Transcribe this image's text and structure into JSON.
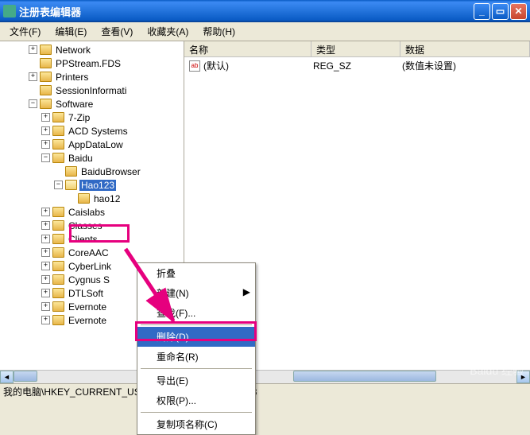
{
  "window": {
    "title": "注册表编辑器"
  },
  "menubar": {
    "file": "文件(F)",
    "edit": "编辑(E)",
    "view": "查看(V)",
    "favorites": "收藏夹(A)",
    "help": "帮助(H)"
  },
  "tree": {
    "nodes": [
      {
        "indent": 2,
        "exp": "plus",
        "label": "Network"
      },
      {
        "indent": 2,
        "exp": "none",
        "label": "PPStream.FDS"
      },
      {
        "indent": 2,
        "exp": "plus",
        "label": "Printers"
      },
      {
        "indent": 2,
        "exp": "none",
        "label": "SessionInformati"
      },
      {
        "indent": 2,
        "exp": "minus",
        "label": "Software"
      },
      {
        "indent": 3,
        "exp": "plus",
        "label": "7-Zip"
      },
      {
        "indent": 3,
        "exp": "plus",
        "label": "ACD Systems"
      },
      {
        "indent": 3,
        "exp": "plus",
        "label": "AppDataLow"
      },
      {
        "indent": 3,
        "exp": "minus",
        "label": "Baidu"
      },
      {
        "indent": 4,
        "exp": "none",
        "label": "BaiduBrowser"
      },
      {
        "indent": 4,
        "exp": "minus",
        "label": "Hao123",
        "selected": true,
        "open": true
      },
      {
        "indent": 5,
        "exp": "none",
        "label": "hao12"
      },
      {
        "indent": 3,
        "exp": "plus",
        "label": "Caislabs"
      },
      {
        "indent": 3,
        "exp": "plus",
        "label": "Classes"
      },
      {
        "indent": 3,
        "exp": "plus",
        "label": "Clients"
      },
      {
        "indent": 3,
        "exp": "plus",
        "label": "CoreAAC"
      },
      {
        "indent": 3,
        "exp": "plus",
        "label": "CyberLink"
      },
      {
        "indent": 3,
        "exp": "plus",
        "label": "Cygnus S"
      },
      {
        "indent": 3,
        "exp": "plus",
        "label": "DTLSoft"
      },
      {
        "indent": 3,
        "exp": "plus",
        "label": "Evernote"
      },
      {
        "indent": 3,
        "exp": "plus",
        "label": "Evernote"
      }
    ]
  },
  "list": {
    "headers": {
      "name": "名称",
      "type": "类型",
      "data": "数据"
    },
    "rows": [
      {
        "name": "(默认)",
        "type": "REG_SZ",
        "data": "(数值未设置)"
      }
    ]
  },
  "context_menu": {
    "collapse": "折叠",
    "new": "新建(N)",
    "find": "查找(F)...",
    "delete": "删除(D)",
    "rename": "重命名(R)",
    "export": "导出(E)",
    "permissions": "权限(P)...",
    "copy_key": "复制项名称(C)"
  },
  "statusbar": {
    "path": "我的电脑\\HKEY_CURRENT_USER\\Software\\Baidu\\Hao123"
  },
  "watermark": "Baidu 经验"
}
